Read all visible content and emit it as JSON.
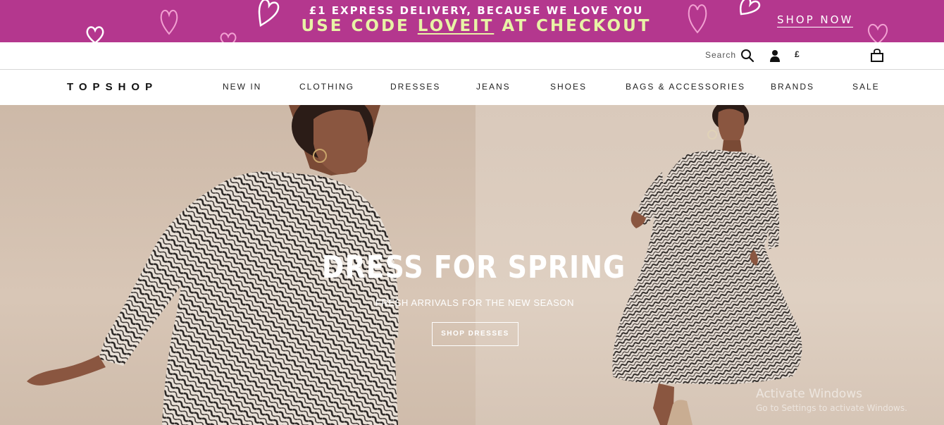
{
  "promo": {
    "line1": "£1 EXPRESS DELIVERY, BECAUSE WE LOVE YOU",
    "line2_prefix": "USE CODE",
    "code": "LOVEIT",
    "line2_suffix": "AT CHECKOUT",
    "cta": "SHOP NOW",
    "background": "#b4378e",
    "heart_color": "#f2a0d2"
  },
  "utility": {
    "search_label": "Search",
    "search_icon": "search-icon",
    "account_icon": "user-icon",
    "currency": "£",
    "bag_icon": "shopping-bag-icon"
  },
  "nav": {
    "logo": "TOPSHOP",
    "items": [
      "NEW IN",
      "CLOTHING",
      "DRESSES",
      "JEANS",
      "SHOES",
      "BAGS & ACCESSORIES",
      "BRANDS",
      "SALE"
    ]
  },
  "hero": {
    "title": "DRESS FOR SPRING",
    "subtitle": "FRESH ARRIVALS FOR THE NEW SEASON",
    "cta": "SHOP DRESSES"
  },
  "watermark": {
    "line1": "Activate Windows",
    "line2": "Go to Settings to activate Windows."
  }
}
